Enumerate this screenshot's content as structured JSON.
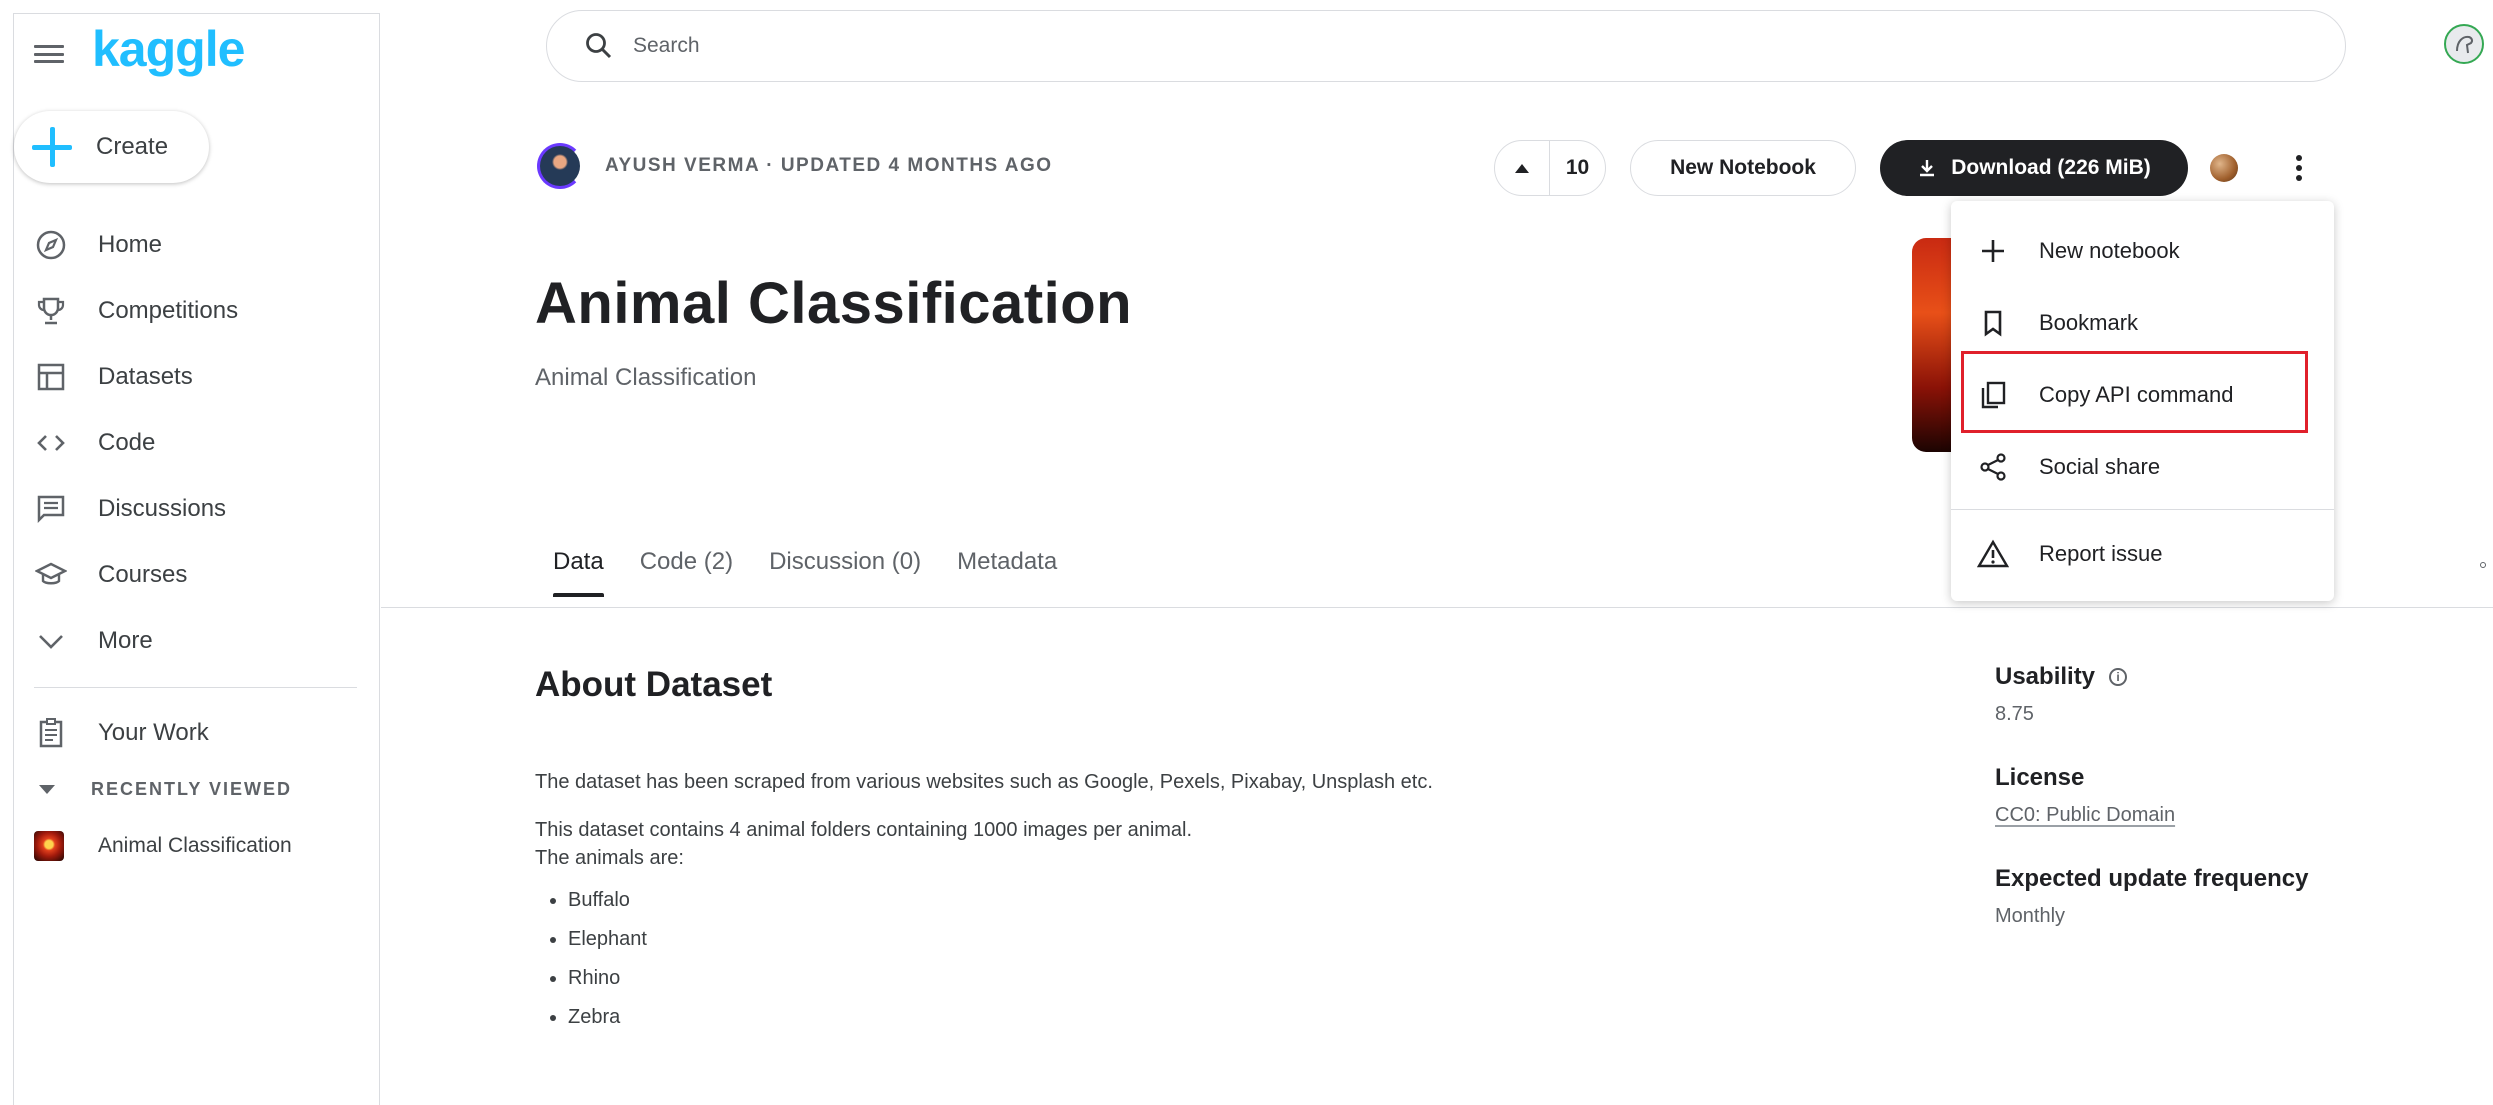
{
  "brand": {
    "logo_text": "kaggle",
    "color": "#20beff"
  },
  "sidebar": {
    "create_label": "Create",
    "items": [
      {
        "label": "Home",
        "icon": "compass-icon"
      },
      {
        "label": "Competitions",
        "icon": "trophy-icon"
      },
      {
        "label": "Datasets",
        "icon": "table-icon"
      },
      {
        "label": "Code",
        "icon": "code-icon"
      },
      {
        "label": "Discussions",
        "icon": "comment-icon"
      },
      {
        "label": "Courses",
        "icon": "school-icon"
      },
      {
        "label": "More",
        "icon": "chevron-down-icon"
      }
    ],
    "your_work_label": "Your Work",
    "recently_viewed_label": "RECENTLY VIEWED",
    "recent_items": [
      {
        "label": "Animal Classification"
      }
    ]
  },
  "search": {
    "placeholder": "Search"
  },
  "dataset": {
    "byline": "AYUSH VERMA · UPDATED 4 MONTHS AGO",
    "vote_count": "10",
    "new_notebook_label": "New Notebook",
    "download_label": "Download (226 MiB)",
    "title": "Animal Classification",
    "subtitle": "Animal Classification"
  },
  "tabs": [
    {
      "label": "Data",
      "active": true
    },
    {
      "label": "Code (2)",
      "active": false
    },
    {
      "label": "Discussion (0)",
      "active": false
    },
    {
      "label": "Metadata",
      "active": false
    }
  ],
  "about": {
    "heading": "About Dataset",
    "para1": "The dataset has been scraped from various websites such as Google, Pexels, Pixabay, Unsplash etc.",
    "para2": "This dataset contains 4 animal folders containing 1000 images per animal.",
    "para3": "The animals are:",
    "animals": [
      "Buffalo",
      "Elephant",
      "Rhino",
      "Zebra"
    ]
  },
  "meta": {
    "usability_label": "Usability",
    "usability_value": "8.75",
    "license_label": "License",
    "license_value": "CC0: Public Domain",
    "frequency_label": "Expected update frequency",
    "frequency_value": "Monthly"
  },
  "menu": {
    "items": [
      {
        "label": "New notebook",
        "icon": "plus-icon"
      },
      {
        "label": "Bookmark",
        "icon": "bookmark-icon"
      },
      {
        "label": "Copy API command",
        "icon": "copy-icon",
        "highlighted": true
      },
      {
        "label": "Social share",
        "icon": "share-icon"
      },
      {
        "label": "Report issue",
        "icon": "warning-icon"
      }
    ],
    "highlight_color": "#e0202b"
  }
}
